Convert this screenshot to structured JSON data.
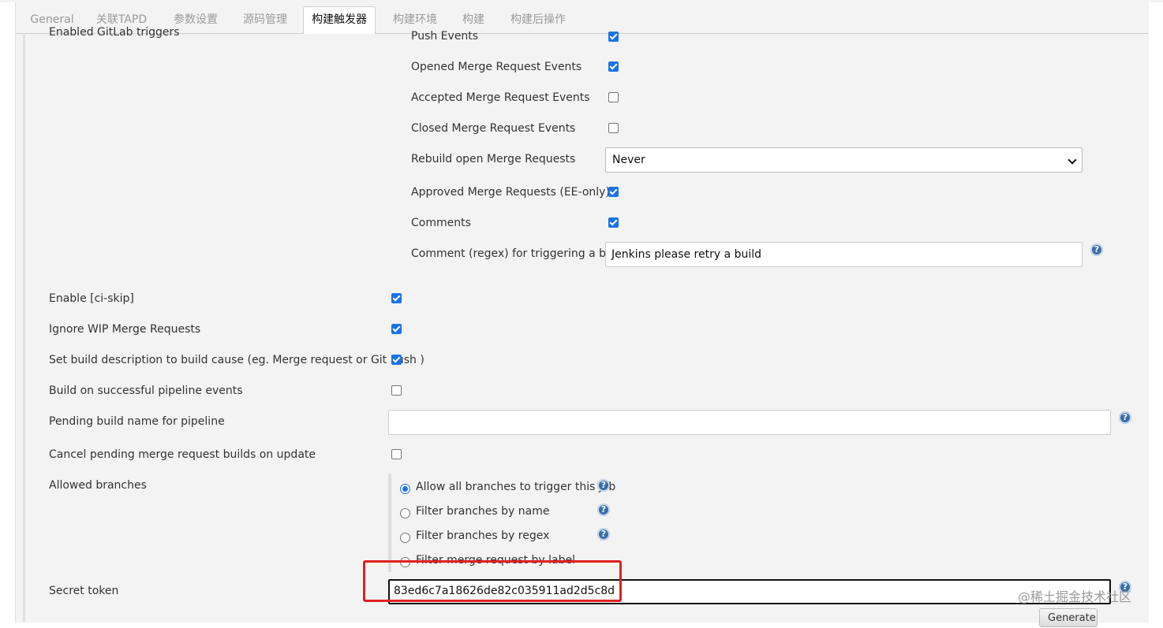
{
  "tabs": [
    {
      "label": "General"
    },
    {
      "label": "关联TAPD"
    },
    {
      "label": "参数设置"
    },
    {
      "label": "源码管理"
    },
    {
      "label": "构建触发器"
    },
    {
      "label": "构建环境"
    },
    {
      "label": "构建"
    },
    {
      "label": "构建后操作"
    }
  ],
  "active_tab": "构建触发器",
  "gitlab": {
    "section_label": "Enabled GitLab triggers",
    "push_events": {
      "label": "Push Events",
      "checked": true
    },
    "opened_mr": {
      "label": "Opened Merge Request Events",
      "checked": true
    },
    "accepted_mr": {
      "label": "Accepted Merge Request Events",
      "checked": false
    },
    "closed_mr": {
      "label": "Closed Merge Request Events",
      "checked": false
    },
    "rebuild_open_mr": {
      "label": "Rebuild open Merge Requests",
      "value": "Never"
    },
    "approved_mr": {
      "label": "Approved Merge Requests (EE-only)",
      "checked": true
    },
    "comments": {
      "label": "Comments",
      "checked": true
    },
    "comment_regex": {
      "label": "Comment (regex) for triggering a build",
      "value": "Jenkins please retry a build"
    }
  },
  "options": {
    "ci_skip": {
      "label": "Enable [ci-skip]",
      "checked": true
    },
    "ignore_wip": {
      "label": "Ignore WIP Merge Requests",
      "checked": true
    },
    "set_build_desc": {
      "label": "Set build description to build cause (eg. Merge request or Git Push )",
      "checked": true
    },
    "build_on_pipeline": {
      "label": "Build on successful pipeline events",
      "checked": false
    },
    "pending_build_name": {
      "label": "Pending build name for pipeline",
      "value": ""
    },
    "cancel_pending": {
      "label": "Cancel pending merge request builds on update",
      "checked": false
    }
  },
  "allowed_branches": {
    "label": "Allowed branches",
    "options": [
      {
        "label": "Allow all branches to trigger this job",
        "selected": true
      },
      {
        "label": "Filter branches by name",
        "selected": false
      },
      {
        "label": "Filter branches by regex",
        "selected": false
      },
      {
        "label": "Filter merge request by label",
        "selected": false
      }
    ]
  },
  "secret_token": {
    "label": "Secret token",
    "value": "83ed6c7a18626de82c035911ad2d5c8d"
  },
  "generate_button": "Generate",
  "help_glyph": "?",
  "watermark": "@稀土掘金技术社区",
  "colors": {
    "accent": "#1a73e8",
    "highlight_box": "#e02020",
    "help_icon": "#3a6ea8"
  }
}
